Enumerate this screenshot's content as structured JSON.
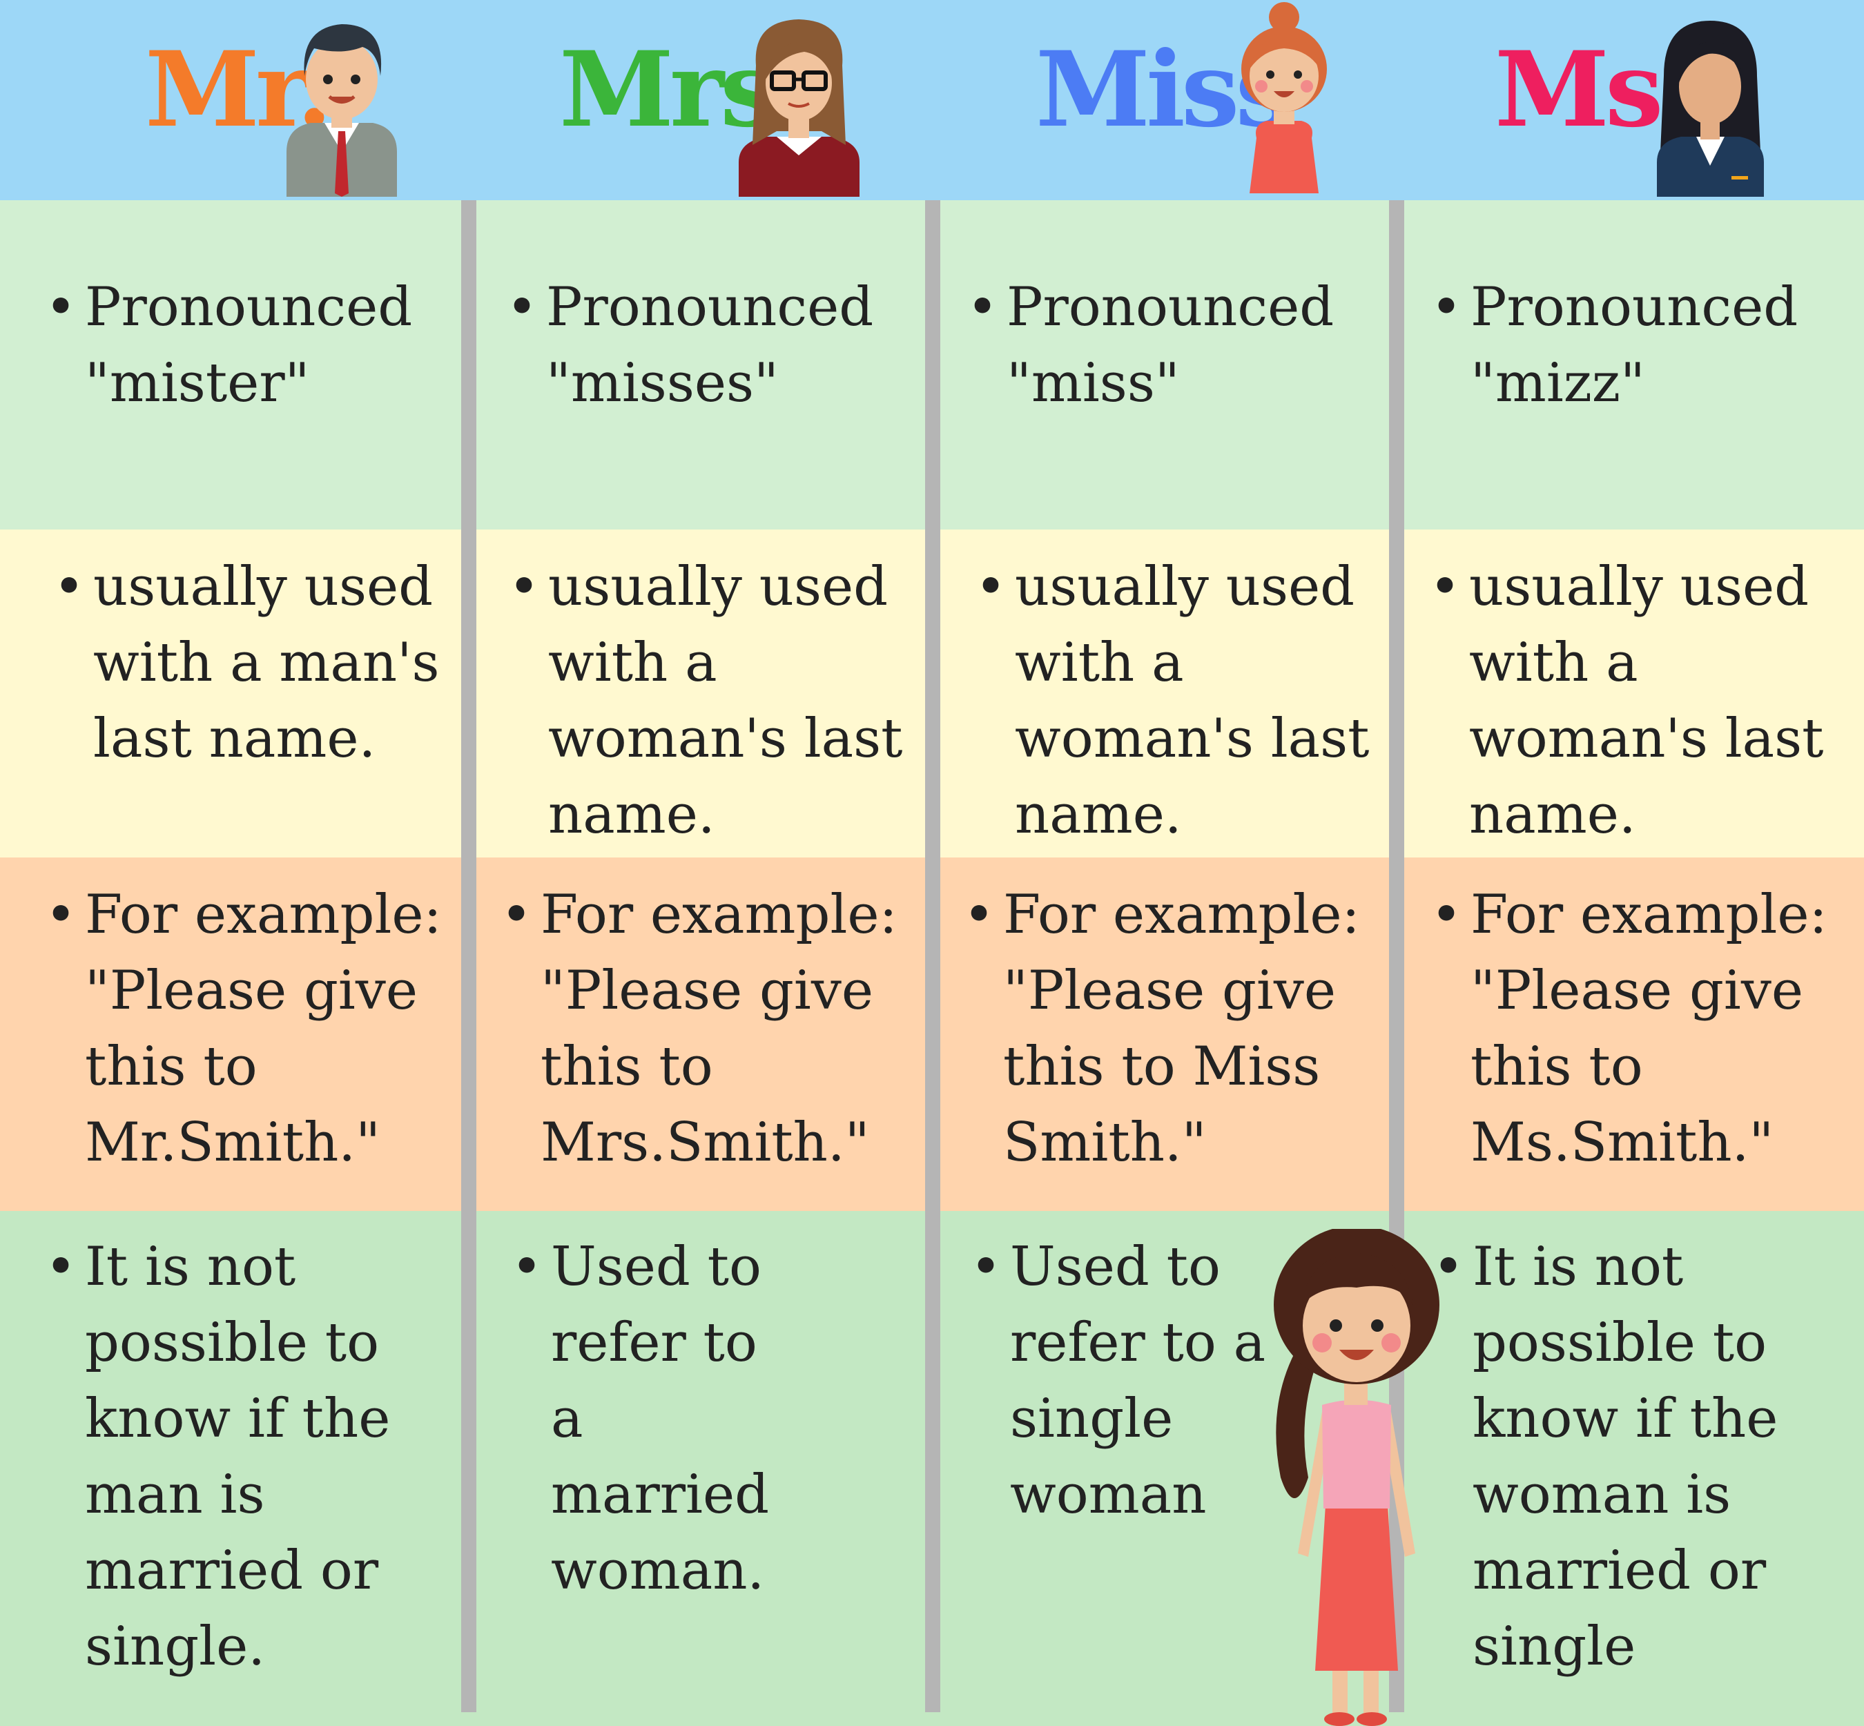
{
  "header": {
    "titles": [
      {
        "label": "Mr.",
        "color": "#f47b2a"
      },
      {
        "label": "Mrs.",
        "color": "#3bb53a"
      },
      {
        "label": "Miss",
        "color": "#4c7cf4"
      },
      {
        "label": "Ms.",
        "color": "#ee1f5f"
      }
    ]
  },
  "rows": {
    "pronounced": [
      "Pronounced\n\"mister\"",
      "Pronounced\n\"misses\"",
      "Pronounced\n\"miss\"",
      "Pronounced\n\"mizz\""
    ],
    "usage": [
      "usually used\nwith a man's\nlast name.",
      "usually used\nwith a\nwoman's last\nname.",
      "usually used\nwith a\nwoman's last\nname.",
      "usually used\nwith a\nwoman's last\nname."
    ],
    "example": [
      "For example:\n\"Please give\nthis to\nMr.Smith.\"",
      "For example:\n\"Please give\nthis to\nMrs.Smith.\"",
      "For example:\n\"Please give\nthis to Miss\nSmith.\"",
      "For example:\n\"Please give\nthis to\nMs.Smith.\""
    ],
    "meaning": [
      "It is not\npossible to\nknow if the\nman is\nmarried or\nsingle.",
      "Used to\nrefer to\na\nmarried\nwoman.",
      "Used to\nrefer to a\nsingle\nwoman",
      "It is not\npossible to\nknow if the\nwoman is\nmarried or\nsingle"
    ]
  },
  "bullet": "•",
  "icons": [
    "man-avatar-icon",
    "woman-glasses-avatar-icon",
    "girl-bun-avatar-icon",
    "businesswoman-avatar-icon",
    "girl-standing-illustration"
  ]
}
